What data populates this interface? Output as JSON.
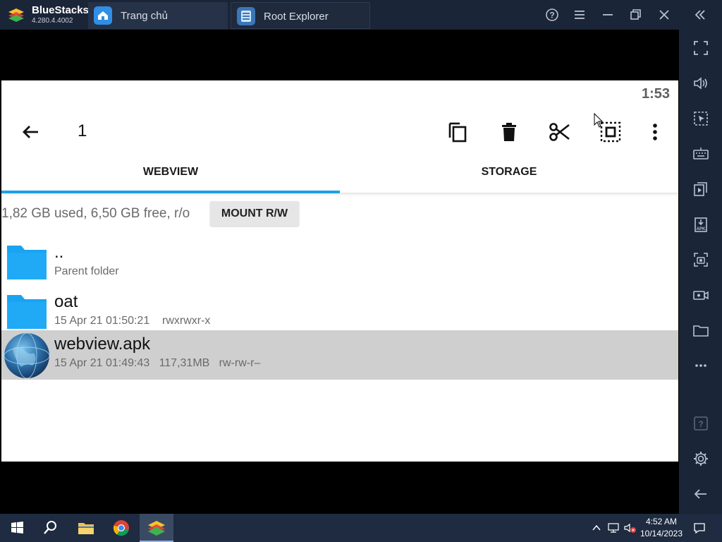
{
  "window": {
    "app_name": "BlueStacks",
    "version": "4.280.4.4002",
    "tabs": [
      {
        "label": "Trang chủ"
      },
      {
        "label": "Root Explorer"
      }
    ]
  },
  "status": {
    "time": "1:53"
  },
  "action_bar": {
    "selected_count": "1"
  },
  "tabs": [
    {
      "label": "WEBVIEW"
    },
    {
      "label": "STORAGE"
    }
  ],
  "storage": {
    "info": "1,82 GB used, 6,50 GB free, r/o",
    "mount_label": "MOUNT R/W"
  },
  "files": [
    {
      "name": "..",
      "meta": "Parent folder",
      "icon": "folder-icon"
    },
    {
      "name": "oat",
      "meta": "15 Apr 21 01:50:21    rwxrwxr-x",
      "icon": "folder-icon"
    },
    {
      "name": "webview.apk",
      "meta": "15 Apr 21 01:49:43   117,31MB   rw-rw-r–",
      "icon": "globe-icon",
      "selected": true
    }
  ],
  "taskbar": {
    "time": "4:52 AM",
    "date": "10/14/2023"
  },
  "colors": {
    "accent": "#1ea1e6",
    "folder": "#1aa3f0",
    "selected_row": "#cfcfcf",
    "chrome": "#1b2538"
  }
}
